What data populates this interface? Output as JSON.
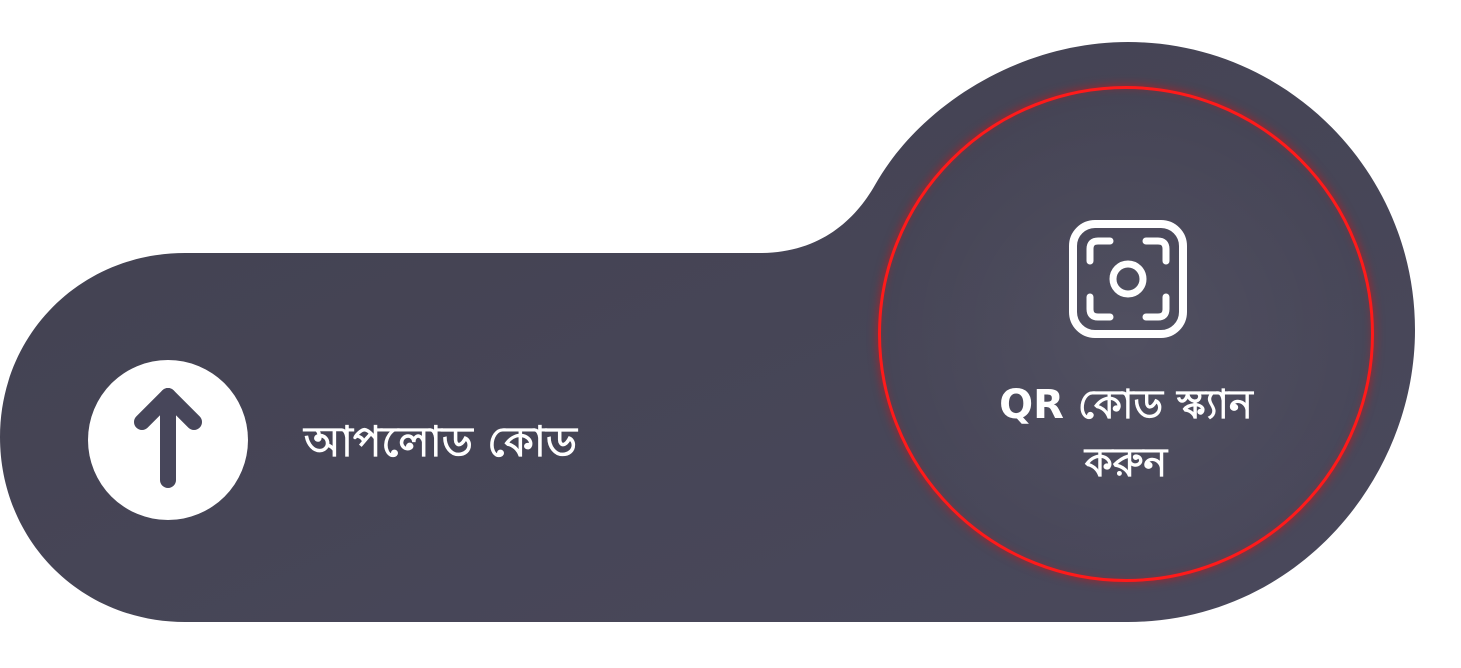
{
  "upload": {
    "label": "আপলোড কোড",
    "icon": "arrow-up-icon"
  },
  "scan": {
    "label_line1": "QR কোড স্ক্যান",
    "label_line2": "করুন",
    "icon": "camera-focus-icon"
  },
  "colors": {
    "panel": "#47465a",
    "ring": "#ff1a1a",
    "foreground": "#ffffff",
    "background": "#ffffff"
  }
}
